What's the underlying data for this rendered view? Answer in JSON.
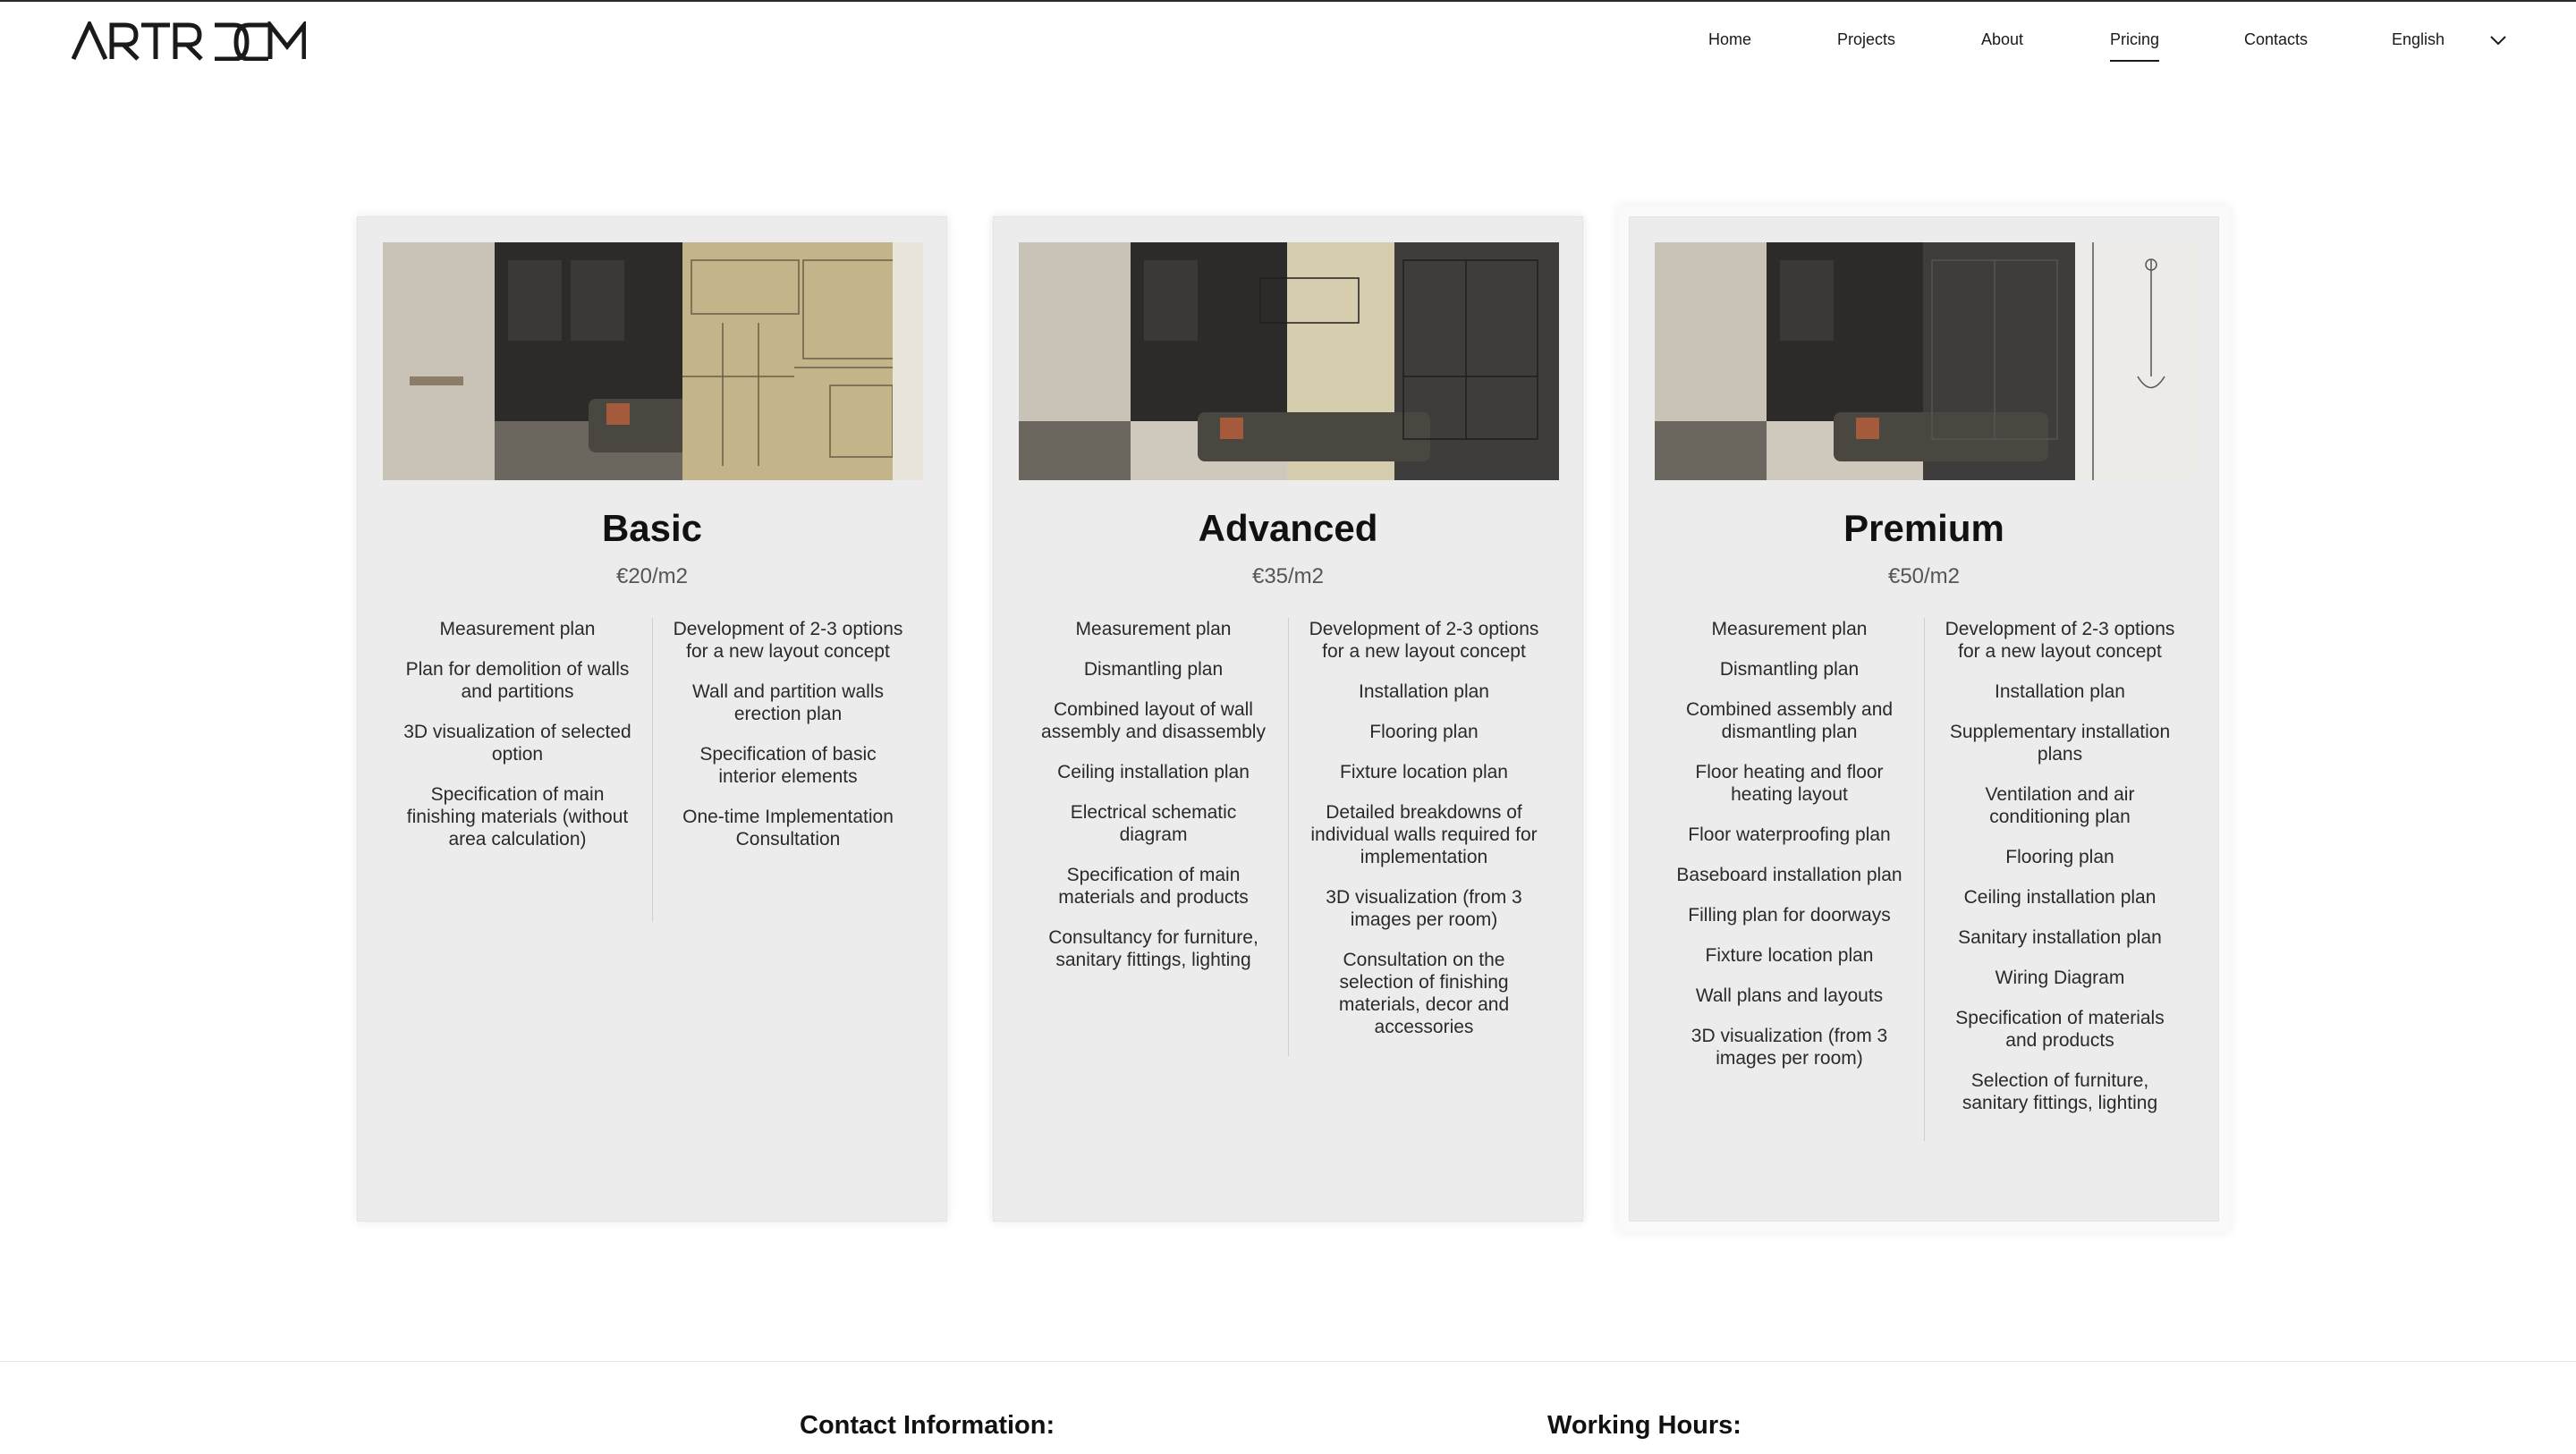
{
  "brand": {
    "logo_text": "ARTROOM"
  },
  "nav": {
    "items": [
      {
        "label": "Home",
        "active": false
      },
      {
        "label": "Projects",
        "active": false
      },
      {
        "label": "About",
        "active": false
      },
      {
        "label": "Pricing",
        "active": true
      },
      {
        "label": "Contacts",
        "active": false
      }
    ],
    "language": "English"
  },
  "plans": [
    {
      "title": "Basic",
      "price": "€20/m2",
      "left": [
        "Measurement plan",
        "Plan for demolition of walls and partitions",
        "3D visualization of selected option",
        "Specification of main finishing materials (without area calculation)"
      ],
      "right": [
        "Development of 2-3 options for a new layout concept",
        "Wall and partition walls erection plan",
        "Specification of basic interior elements",
        "One-time Implementation Consultation"
      ]
    },
    {
      "title": "Advanced",
      "price": "€35/m2",
      "left": [
        "Measurement plan",
        "Dismantling plan",
        "Combined layout of wall assembly and disassembly",
        "Ceiling installation plan",
        "Electrical schematic diagram",
        "Specification of main materials and products",
        "Consultancy for furniture, sanitary fittings, lighting"
      ],
      "right": [
        "Development of 2-3 options for a new layout concept",
        "Installation plan",
        "Flooring plan",
        "Fixture location plan",
        "Detailed breakdowns of individual walls required for implementation",
        "3D visualization (from 3 images per room)",
        "Consultation on the selection of finishing materials, decor and accessories"
      ]
    },
    {
      "title": "Premium",
      "price": "€50/m2",
      "left": [
        "Measurement plan",
        "Dismantling plan",
        "Combined assembly and dismantling plan",
        "Floor heating and floor heating layout",
        "Floor waterproofing plan",
        "Baseboard installation plan",
        "Filling plan for doorways",
        "Fixture location plan",
        "Wall plans and layouts",
        "3D visualization (from 3 images per room)"
      ],
      "right": [
        "Development of 2-3 options for a new layout concept",
        "Installation plan",
        "Supplementary installation plans",
        "Ventilation and air conditioning plan",
        "Flooring plan",
        "Ceiling installation plan",
        "Sanitary installation plan",
        "Wiring Diagram",
        "Specification of materials and products",
        "Selection of furniture, sanitary fittings, lighting"
      ]
    }
  ],
  "footer": {
    "contact_heading": "Contact Information:",
    "hours_heading": "Working Hours:"
  }
}
